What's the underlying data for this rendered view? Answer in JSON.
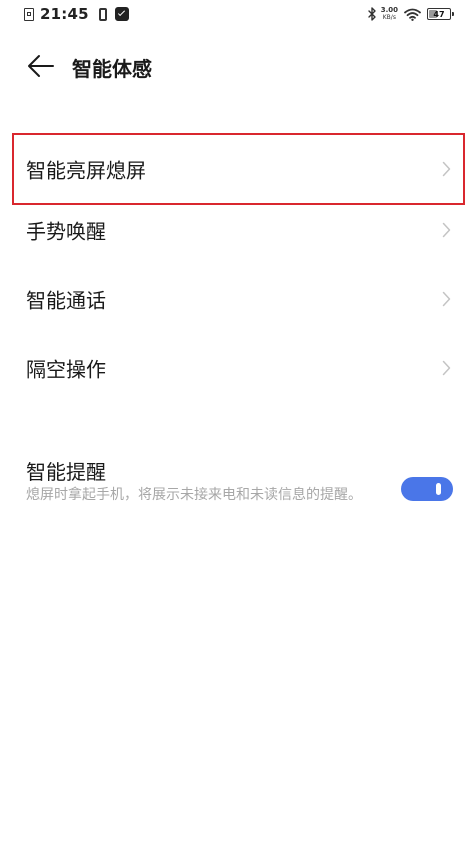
{
  "status_bar": {
    "time": "21:45",
    "network_speed_value": "3.00",
    "network_speed_unit": "KB/s",
    "battery_level": "47",
    "battery_percent": 47,
    "icons": [
      "sim-icon",
      "phone-icon",
      "message-icon",
      "bluetooth-icon",
      "wifi-icon",
      "battery-icon"
    ]
  },
  "header": {
    "title": "智能体感",
    "back_icon": "back-arrow-icon"
  },
  "menu": {
    "items": [
      {
        "label": "智能亮屏熄屏",
        "icon": "chevron-right-icon"
      },
      {
        "label": "手势唤醒",
        "icon": "chevron-right-icon"
      },
      {
        "label": "智能通话",
        "icon": "chevron-right-icon"
      },
      {
        "label": "隔空操作",
        "icon": "chevron-right-icon"
      }
    ]
  },
  "smart_reminder": {
    "title": "智能提醒",
    "description": "熄屏时拿起手机，将展示未接来电和未读信息的提醒。",
    "enabled": true
  },
  "colors": {
    "accent": "#4a76e8",
    "highlight_border": "#d9272e",
    "secondary_text": "#a7a7a7",
    "chevron": "#c4c4c4"
  }
}
